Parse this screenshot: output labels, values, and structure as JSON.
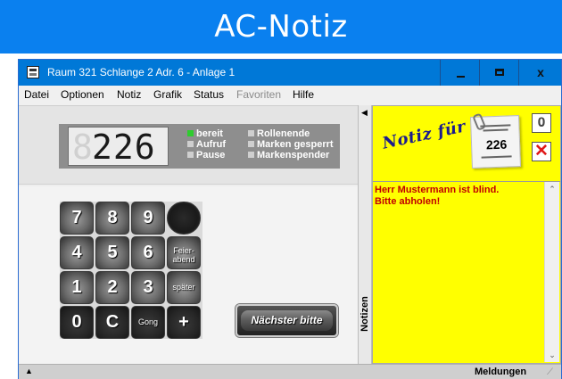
{
  "banner": {
    "title": "AC-Notiz"
  },
  "window": {
    "title": "Raum 321 Schlange 2 Adr. 6 - Anlage 1",
    "close_glyph": "x"
  },
  "menu": {
    "items": [
      {
        "label": "Datei",
        "disabled": false
      },
      {
        "label": "Optionen",
        "disabled": false
      },
      {
        "label": "Notiz",
        "disabled": false
      },
      {
        "label": "Grafik",
        "disabled": false
      },
      {
        "label": "Status",
        "disabled": false
      },
      {
        "label": "Favoriten",
        "disabled": true
      },
      {
        "label": "Hilfe",
        "disabled": false
      }
    ]
  },
  "display": {
    "ghost_digit": "8",
    "number": "226",
    "status_left": [
      {
        "label": "bereit",
        "active": true
      },
      {
        "label": "Aufruf",
        "active": false
      },
      {
        "label": "Pause",
        "active": false
      }
    ],
    "status_right": [
      {
        "label": "Rollenende"
      },
      {
        "label": "Marken gesperrt"
      },
      {
        "label": "Markenspender"
      }
    ]
  },
  "keypad": {
    "keys": [
      {
        "label": "7"
      },
      {
        "label": "8"
      },
      {
        "label": "9"
      },
      {
        "label": ""
      },
      {
        "label": "4"
      },
      {
        "label": "5"
      },
      {
        "label": "6"
      },
      {
        "label": "Feier-\nabend"
      },
      {
        "label": "1"
      },
      {
        "label": "2"
      },
      {
        "label": "3"
      },
      {
        "label": "später"
      },
      {
        "label": "0"
      },
      {
        "label": "C"
      },
      {
        "label": "Gong"
      },
      {
        "label": "+"
      }
    ],
    "next_button": "Nächster bitte"
  },
  "notes": {
    "panel_label": "Notizen",
    "header_script": "Notiz für",
    "ticket_number": "226",
    "text": "Herr Mustermann ist blind.\nBitte abholen!"
  },
  "statusbar": {
    "label": "Meldungen"
  },
  "colors": {
    "banner_bg": "#0a80ef",
    "titlebar_bg": "#0078d7",
    "notes_bg": "#ffff00",
    "note_text": "#c00000",
    "active_status": "#2ecc2e"
  }
}
